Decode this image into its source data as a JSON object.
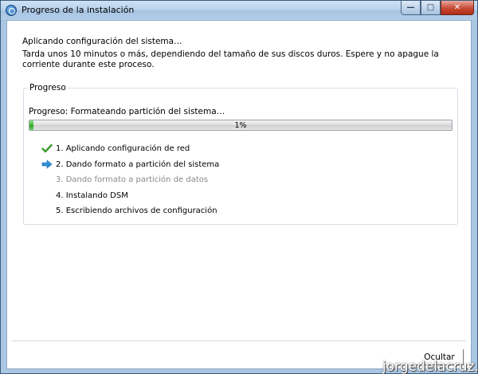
{
  "window": {
    "title": "Progreso de la instalación",
    "controls": {
      "minimize": "—",
      "maximize": "□",
      "close": "✕"
    }
  },
  "main": {
    "heading": "Aplicando configuración del sistema…",
    "description": "Tarda unos 10 minutos o más, dependiendo del tamaño de sus discos duros. Espere y no apague la corriente durante este proceso."
  },
  "progress_group": {
    "legend": "Progreso",
    "status": "Progreso: Formateando partición del sistema…",
    "percent_label": "1%",
    "percent": 1,
    "steps": [
      {
        "label": "1. Aplicando configuración de red",
        "state": "done",
        "icon": "checkmark-icon"
      },
      {
        "label": "2. Dando formato a partición del sistema",
        "state": "current",
        "icon": "arrow-right-icon"
      },
      {
        "label": "3. Dando formato a partición de datos",
        "state": "pending",
        "icon": ""
      },
      {
        "label": "4. Instalando DSM",
        "state": "normal",
        "icon": ""
      },
      {
        "label": "5. Escribiendo archivos de configuración",
        "state": "normal",
        "icon": ""
      }
    ]
  },
  "footer": {
    "hide_button": "Ocultar"
  },
  "watermark": "jorgedelacruz.es",
  "colors": {
    "check": "#3a9a2a",
    "arrow": "#2e8fd8",
    "progress": "#3fb535",
    "pending_text": "#8a8a8a"
  }
}
